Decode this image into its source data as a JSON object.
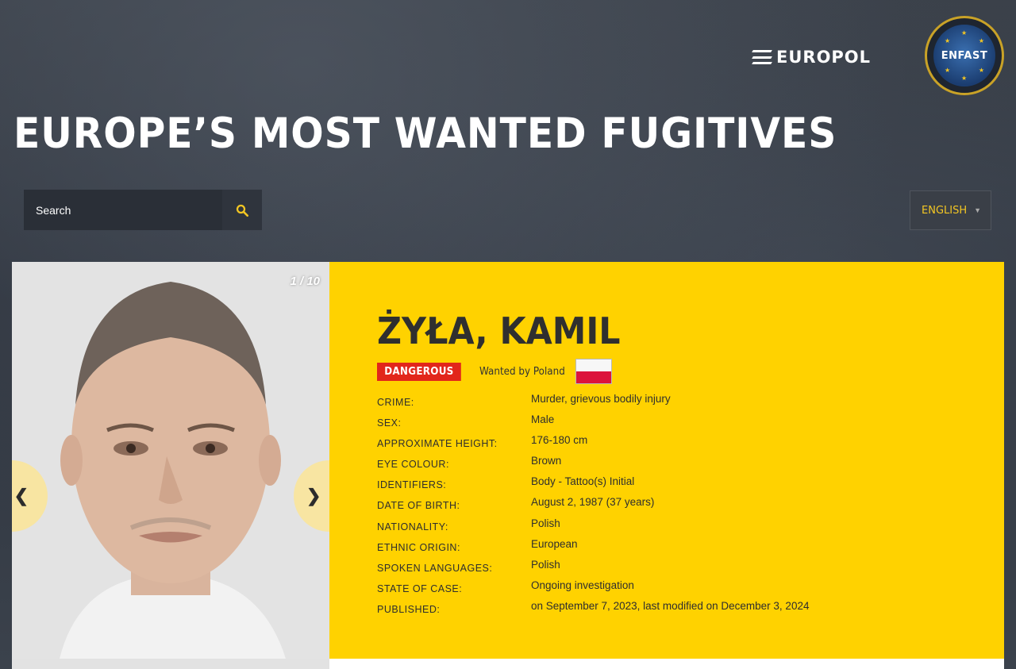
{
  "header": {
    "europol_logo_text": "EUROPOL",
    "enfast_logo_text": "ENFAST",
    "title": "EUROPE’S MOST WANTED FUGITIVES"
  },
  "search": {
    "placeholder": "Search",
    "icon": "search-icon"
  },
  "language": {
    "selected": "ENGLISH",
    "caret": "▼"
  },
  "gallery": {
    "counter": "1 / 10",
    "prev_label": "❮",
    "next_label": "❯"
  },
  "fugitive": {
    "name": "ŻYŁA, KAMIL",
    "badge": "DANGEROUS",
    "wanted_by": "Wanted by Poland",
    "flag": "poland-flag",
    "details": [
      {
        "label": "CRIME:",
        "value": "Murder, grievous bodily injury"
      },
      {
        "label": "SEX:",
        "value": "Male"
      },
      {
        "label": "APPROXIMATE HEIGHT:",
        "value": "176-180 cm"
      },
      {
        "label": "EYE COLOUR:",
        "value": "Brown"
      },
      {
        "label": "IDENTIFIERS:",
        "value": "Body - Tattoo(s) Initial"
      },
      {
        "label": "DATE OF BIRTH:",
        "value": "August 2, 1987 (37 years)"
      },
      {
        "label": "NATIONALITY:",
        "value": "Polish"
      },
      {
        "label": "ETHNIC ORIGIN:",
        "value": "European"
      },
      {
        "label": "SPOKEN LANGUAGES:",
        "value": "Polish"
      },
      {
        "label": "STATE OF CASE:",
        "value": "Ongoing investigation"
      },
      {
        "label": "PUBLISHED:",
        "value": "on September 7, 2023, last modified on December 3, 2024"
      }
    ]
  },
  "colors": {
    "accent_yellow": "#ffd200",
    "badge_red": "#e2261b",
    "lang_text": "#f3c623"
  }
}
